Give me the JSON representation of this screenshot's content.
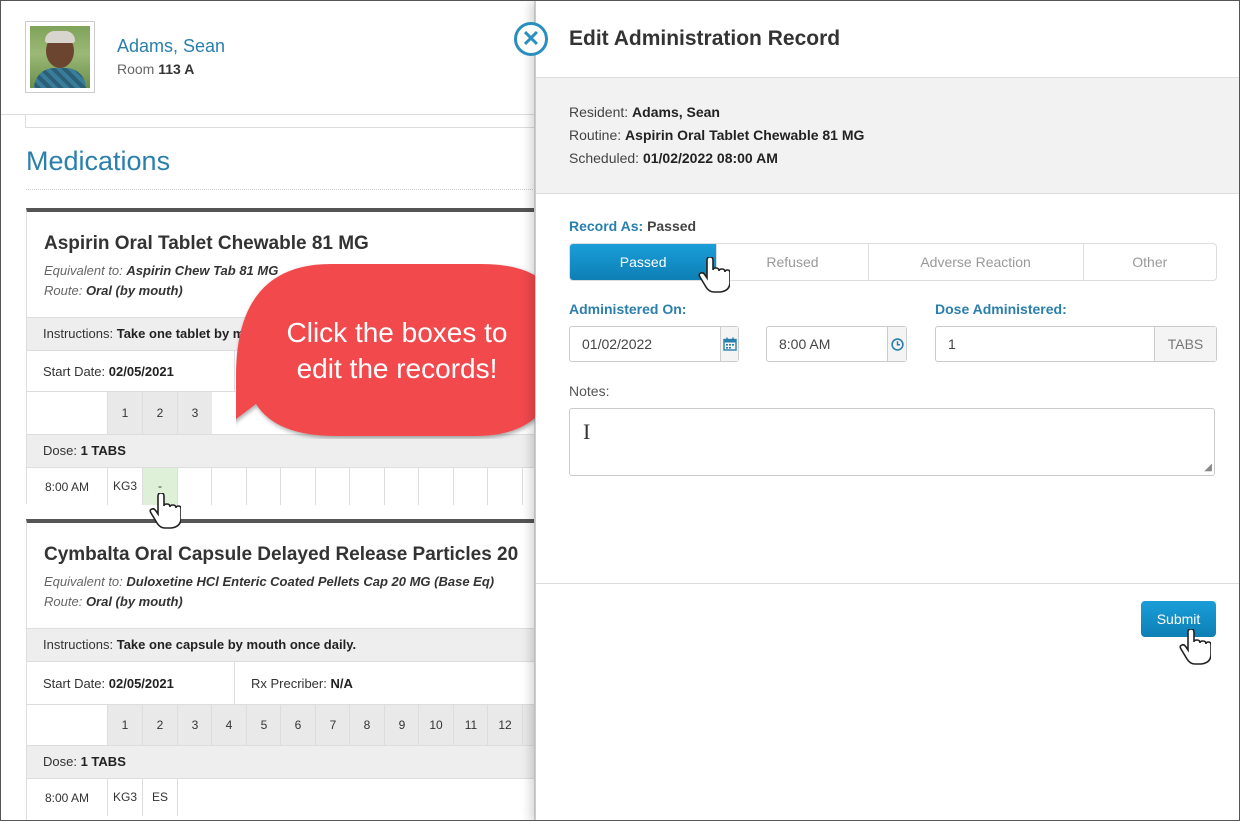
{
  "resident": {
    "name": "Adams, Sean",
    "room_label": "Room",
    "room": "113 A"
  },
  "section_title": "Medications",
  "medications": [
    {
      "name": "Aspirin Oral Tablet Chewable 81 MG",
      "equivalent_label": "Equivalent to:",
      "equivalent": "Aspirin Chew Tab 81 MG",
      "route_label": "Route:",
      "route": "Oral (by mouth)",
      "instructions_label": "Instructions:",
      "instructions": "Take one tablet by m",
      "start_label": "Start Date:",
      "start": "02/05/2021",
      "days": [
        "1",
        "2",
        "3"
      ],
      "dose_label": "Dose:",
      "dose": "1 TABS",
      "time": "8:00 AM",
      "initials": "KG3",
      "day_values": [
        "-"
      ]
    },
    {
      "name": "Cymbalta Oral Capsule Delayed Release Particles 20",
      "equivalent_label": "Equivalent to:",
      "equivalent": "Duloxetine HCl Enteric Coated Pellets Cap 20 MG (Base Eq)",
      "route_label": "Route:",
      "route": "Oral (by mouth)",
      "instructions_label": "Instructions:",
      "instructions": "Take one capsule by mouth once daily.",
      "start_label": "Start Date:",
      "start": "02/05/2021",
      "prescriber_label": "Rx Precriber:",
      "prescriber": "N/A",
      "days": [
        "1",
        "2",
        "3",
        "4",
        "5",
        "6",
        "7",
        "8",
        "9",
        "10",
        "11",
        "12"
      ],
      "dose_label": "Dose:",
      "dose": "1 TABS",
      "time": "8:00 AM",
      "initials": "KG3",
      "day_values": [
        "ES"
      ]
    }
  ],
  "callout": {
    "line1": "Click the boxes to",
    "line2": "edit the records!"
  },
  "panel": {
    "title": "Edit Administration Record",
    "resident_label": "Resident:",
    "resident": "Adams, Sean",
    "routine_label": "Routine:",
    "routine": "Aspirin Oral Tablet Chewable 81 MG",
    "scheduled_label": "Scheduled:",
    "scheduled": "01/02/2022 08:00 AM",
    "record_as_label": "Record As:",
    "record_as": "Passed",
    "options": [
      "Passed",
      "Refused",
      "Adverse Reaction",
      "Other"
    ],
    "administered_on_label": "Administered On:",
    "date": "01/02/2022",
    "time": "8:00 AM",
    "dose_label": "Dose Administered:",
    "dose": "1",
    "dose_unit": "TABS",
    "notes_label": "Notes:",
    "submit": "Submit"
  },
  "colors": {
    "accent": "#2a7fad",
    "button": "#1187c4",
    "callout": "#f24a4d"
  },
  "icons": [
    "close-icon",
    "calendar-icon",
    "clock-icon",
    "hand-pointer-icon",
    "text-cursor-icon"
  ]
}
